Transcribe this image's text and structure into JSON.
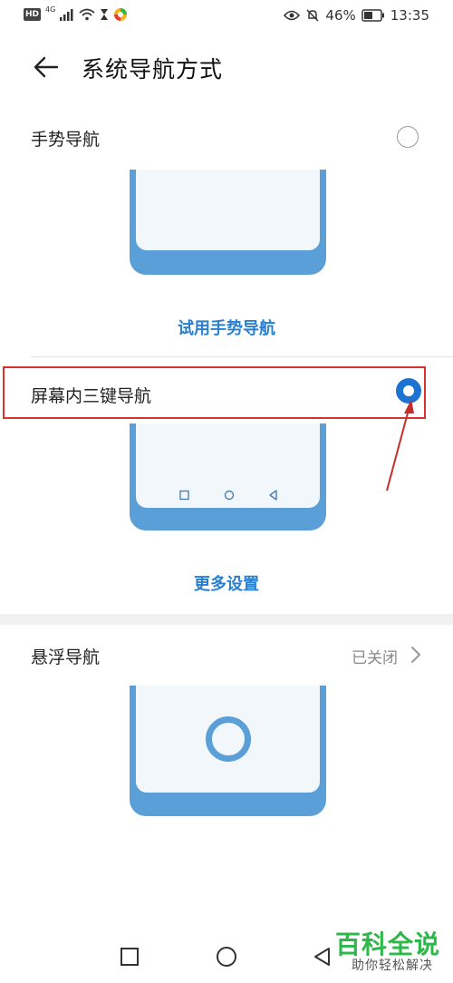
{
  "status_bar": {
    "hd": "HD",
    "network": "4G",
    "battery": "46%",
    "time": "13:35"
  },
  "header": {
    "title": "系统导航方式"
  },
  "gesture": {
    "label": "手势导航",
    "selected": false,
    "link": "试用手势导航"
  },
  "three_key": {
    "label": "屏幕内三键导航",
    "selected": true,
    "link": "更多设置"
  },
  "floating": {
    "label": "悬浮导航",
    "status": "已关闭"
  },
  "watermark": {
    "title": "百科全说",
    "subtitle": "助你轻松解决"
  },
  "colors": {
    "accent": "#1b74d1",
    "illustration": "#5b9fd8",
    "link": "#2a7fce",
    "annotation": "#d9322e",
    "watermark": "#2eb84a"
  }
}
